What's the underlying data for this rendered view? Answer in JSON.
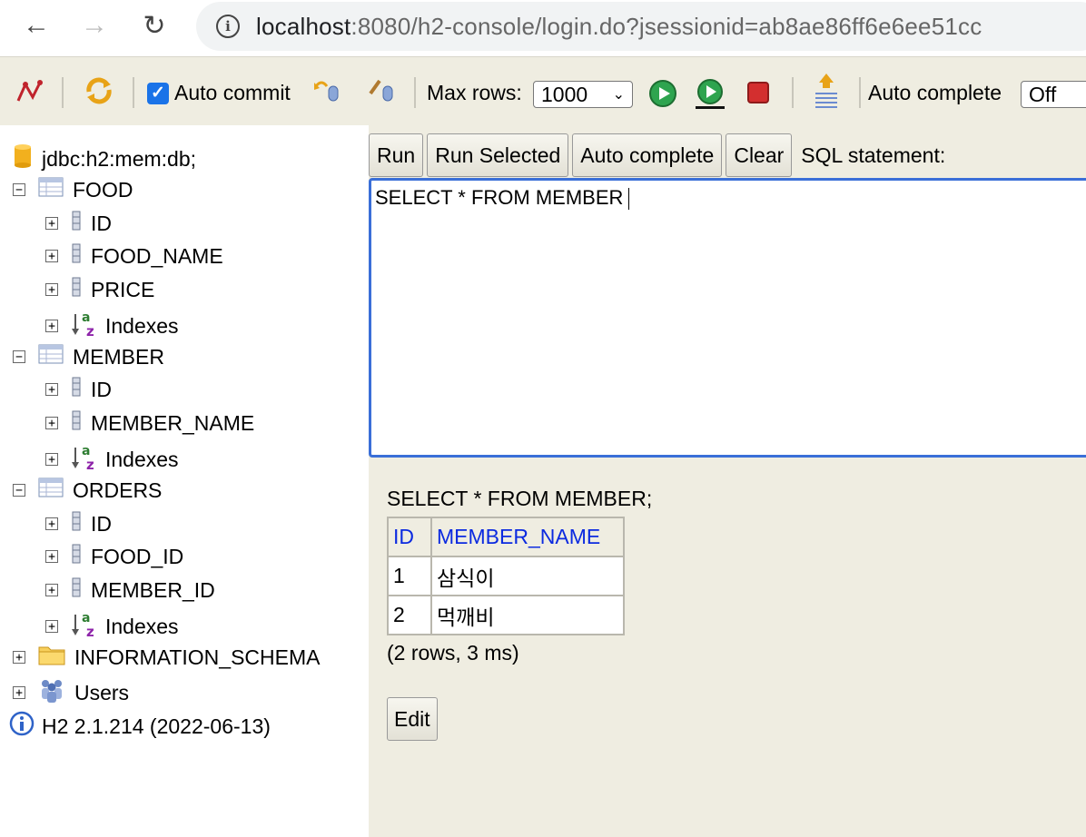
{
  "browser": {
    "url_host": "localhost",
    "url_rest": ":8080/h2-console/login.do?jsessionid=ab8ae86ff6e6ee51cc"
  },
  "toolbar": {
    "auto_commit_label": "Auto commit",
    "max_rows_label": "Max rows:",
    "max_rows_value": "1000",
    "auto_complete_label": "Auto complete",
    "auto_complete_value": "Off"
  },
  "tree": {
    "db": "jdbc:h2:mem:db;",
    "tables": [
      {
        "name": "FOOD",
        "columns": [
          "ID",
          "FOOD_NAME",
          "PRICE"
        ],
        "indexes": "Indexes"
      },
      {
        "name": "MEMBER",
        "columns": [
          "ID",
          "MEMBER_NAME"
        ],
        "indexes": "Indexes"
      },
      {
        "name": "ORDERS",
        "columns": [
          "ID",
          "FOOD_ID",
          "MEMBER_ID"
        ],
        "indexes": "Indexes"
      }
    ],
    "schema": "INFORMATION_SCHEMA",
    "users": "Users",
    "version": "H2 2.1.214 (2022-06-13)"
  },
  "main": {
    "buttons": {
      "run": "Run",
      "run_selected": "Run Selected",
      "auto_complete": "Auto complete",
      "clear": "Clear"
    },
    "sql_label": "SQL statement:",
    "sql_text": "SELECT * FROM MEMBER",
    "result_statement": "SELECT * FROM MEMBER;",
    "result_headers": [
      "ID",
      "MEMBER_NAME"
    ],
    "result_rows": [
      [
        "1",
        "삼식이"
      ],
      [
        "2",
        "먹깨비"
      ]
    ],
    "row_info": "(2 rows, 3 ms)",
    "edit_button": "Edit"
  }
}
